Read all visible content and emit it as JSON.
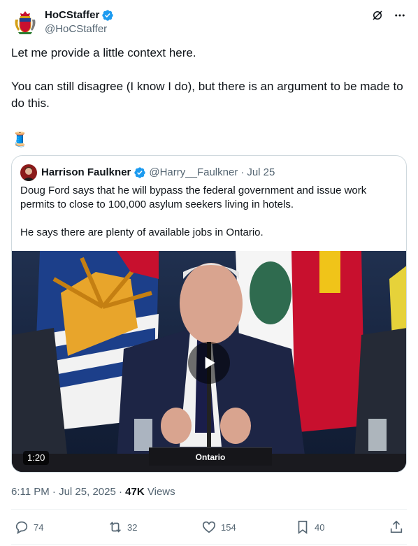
{
  "author": {
    "display_name": "HoCStaffer",
    "handle": "@HoCStaffer"
  },
  "tweet": {
    "paragraph_1": "Let me provide a little context here.",
    "paragraph_2": "You can still disagree (I know I do), but there is an argument to be made to do this.",
    "emoji": "🧵"
  },
  "quote": {
    "author_name": "Harrison Faulkner",
    "author_handle": "@Harry__Faulkner",
    "separator": "·",
    "date": "Jul 25",
    "paragraph_1": "Doug Ford says that he will bypass the federal government and issue work permits to close to 100,000 asylum seekers living in hotels.",
    "paragraph_2": "He says there are plenty of available jobs in Ontario.",
    "video": {
      "duration": "1:20",
      "sign_text": "Ontario"
    }
  },
  "meta": {
    "time": "6:11 PM",
    "separator": "·",
    "date": "Jul 25, 2025",
    "views_count": "47K",
    "views_label": "Views"
  },
  "actions": {
    "replies": "74",
    "reposts": "32",
    "likes": "154",
    "bookmarks": "40"
  },
  "colors": {
    "verified": "#1d9bf0",
    "muted": "#536471",
    "border": "#cfd9de"
  }
}
